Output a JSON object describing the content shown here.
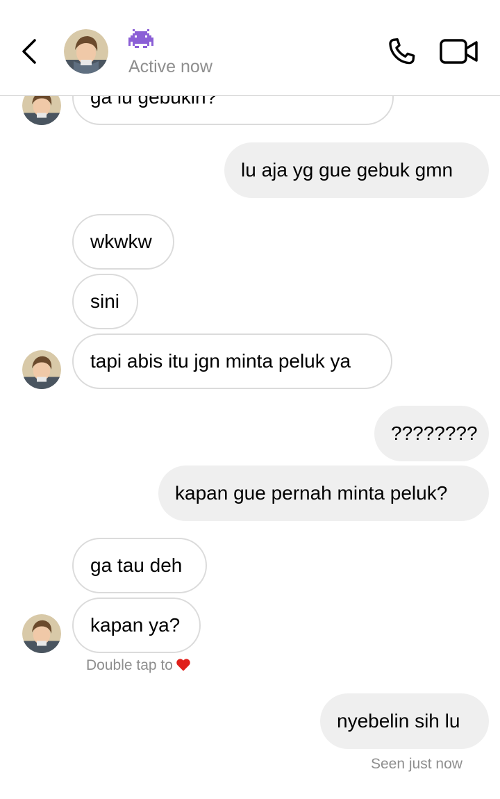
{
  "header": {
    "status": "Active now",
    "emoji_icon": "purple-alien-monster-emoji"
  },
  "messages": [
    {
      "sender": "them",
      "text": "ga lu gebukin?"
    },
    {
      "sender": "me",
      "text": "lu aja yg gue gebuk gmn"
    },
    {
      "sender": "them",
      "text": "wkwkw"
    },
    {
      "sender": "them",
      "text": "sini"
    },
    {
      "sender": "them",
      "text": "tapi abis itu jgn minta peluk ya"
    },
    {
      "sender": "me",
      "text": "????????"
    },
    {
      "sender": "me",
      "text": "kapan gue pernah minta peluk?"
    },
    {
      "sender": "them",
      "text": "ga tau deh"
    },
    {
      "sender": "them",
      "text": "kapan ya?"
    },
    {
      "sender": "me",
      "text": "nyebelin sih lu"
    }
  ],
  "double_tap_hint": "Double tap to",
  "seen_status": "Seen just now",
  "colors": {
    "incoming_bubble_border": "#dbdbdb",
    "outgoing_bubble": "#efefef",
    "secondary_text": "#8e8e8e",
    "heart": "#e0201b"
  }
}
